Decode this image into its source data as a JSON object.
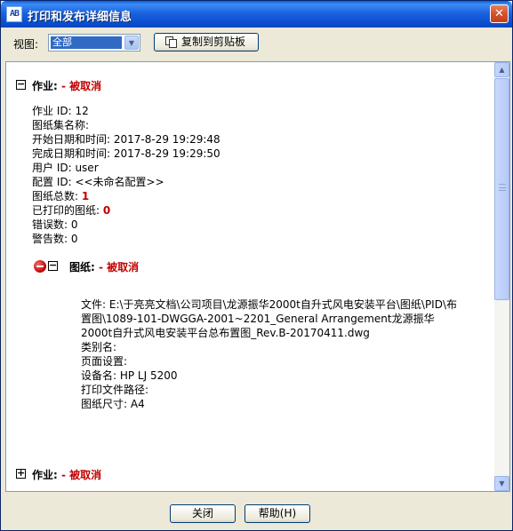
{
  "window": {
    "title": "打印和发布详细信息",
    "app_icon_text": "AB",
    "close_glyph": "✕"
  },
  "toolbar": {
    "view_label": "视图:",
    "view_value": "全部",
    "copy_label": "复制到剪贴板"
  },
  "jobs": [
    {
      "header": "作业:",
      "status": "- 被取消",
      "expanded": true,
      "job_id": "作业 ID: 12",
      "sheet_set_name": "图纸集名称:",
      "start_time": "开始日期和时间: 2017-8-29 19:29:48",
      "end_time": "完成日期和时间: 2017-8-29 19:29:50",
      "user_id": "用户 ID: user",
      "config_id": "配置 ID: <<未命名配置>>",
      "sheet_total_label": "图纸总数:",
      "sheet_total": "1",
      "printed_label": "已打印的图纸:",
      "printed": "0",
      "errors": "错误数: 0",
      "warnings": "警告数: 0",
      "sheet": {
        "header": "图纸:",
        "status": "- 被取消",
        "file_line1": "文件: E:\\于亮亮文档\\公司项目\\龙源振华2000t自升式风电安装平台\\图纸\\PID\\布",
        "file_line2": "置图\\1089-101-DWGGA-2001~2201_General Arrangement龙源振华",
        "file_line3": "2000t自升式风电安装平台总布置图_Rev.B-20170411.dwg",
        "category": "类别名:",
        "page_setup": "页面设置:",
        "device": "设备名: HP LJ 5200",
        "plot_path": "打印文件路径:",
        "paper_size": "图纸尺寸: A4"
      }
    },
    {
      "header": "作业:",
      "status": "- 被取消",
      "expanded": false
    }
  ],
  "expander_glyphs": {
    "collapse": "−",
    "expand": "+"
  },
  "buttons": {
    "close": "关闭",
    "help": "帮助(H)"
  }
}
